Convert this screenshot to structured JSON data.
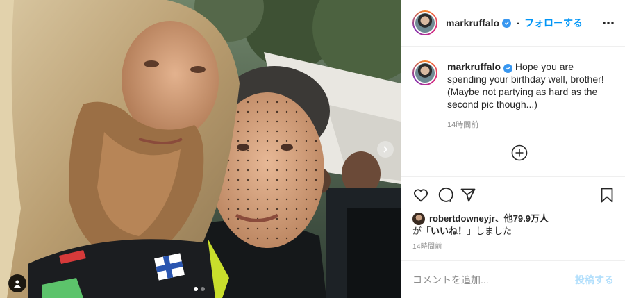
{
  "post": {
    "author": {
      "username": "markruffalo",
      "verified": true,
      "follow_label": "フォローする",
      "separator": "・"
    },
    "icons": {
      "verified": "verified-badge-icon",
      "more": "more-options-icon",
      "load_more": "plus-circle-icon",
      "like": "heart-icon",
      "comment": "comment-icon",
      "share": "paper-plane-icon",
      "save": "bookmark-icon",
      "carousel_next": "chevron-right-icon",
      "user_tags": "user-tag-icon"
    },
    "caption": {
      "username": "markruffalo",
      "text": "Hope you are spending your birthday well, brother! (Maybe not partying as hard as the second pic though...)",
      "time_ago": "14時間前"
    },
    "likes": {
      "line1": "robertdowneyjr、他79.9万人",
      "prefix": "が",
      "highlight": "「いいね！」",
      "suffix": "しました"
    },
    "posted_time": "14時間前",
    "comment_box": {
      "placeholder": "コメントを追加...",
      "post_label": "投稿する"
    },
    "carousel": {
      "slide_count": 2,
      "active_index": 0
    },
    "colors": {
      "accent": "#0095f6",
      "verified": "#3897f0",
      "post_button_disabled": "#b2dffc",
      "muted_text": "#8e8e8e"
    }
  }
}
